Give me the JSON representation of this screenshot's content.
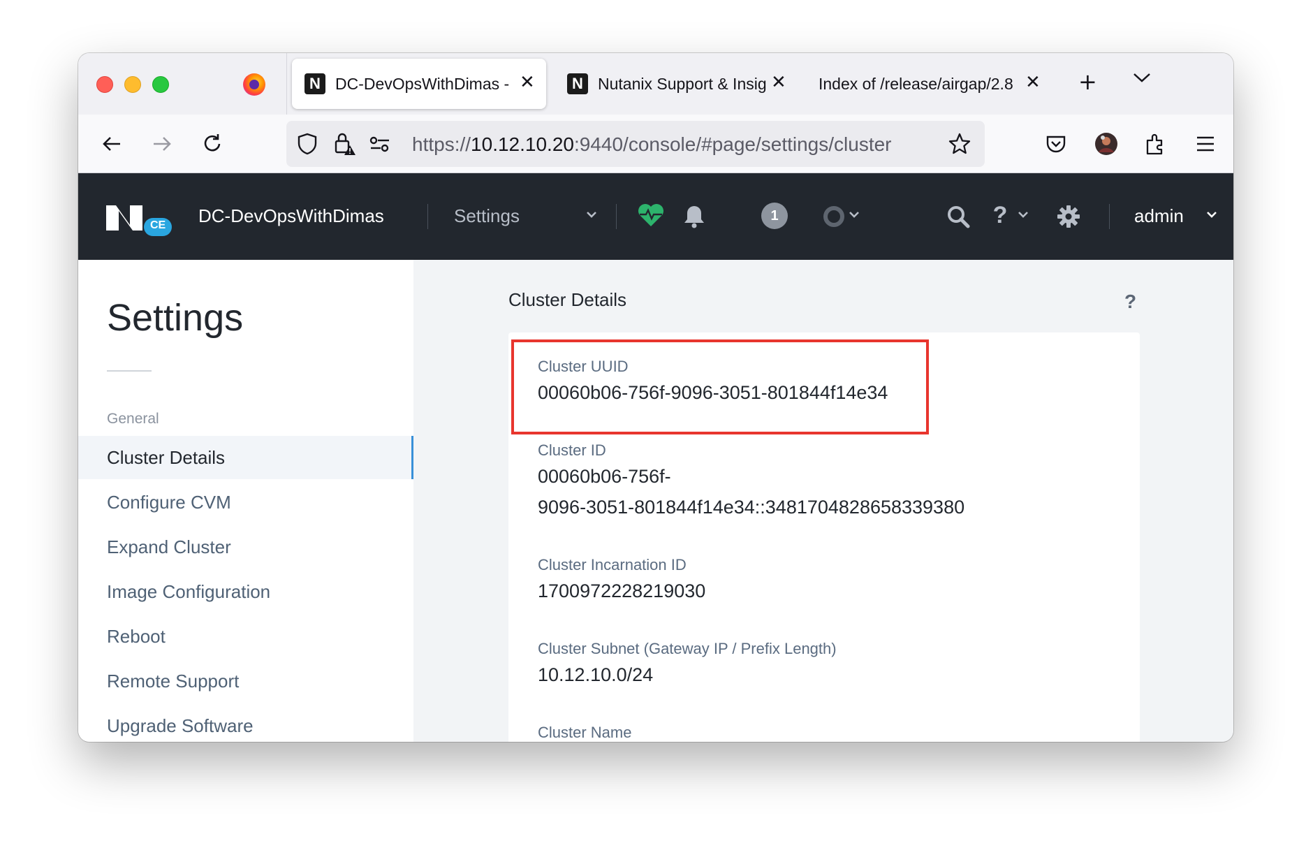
{
  "browser": {
    "tabs": [
      {
        "title": "DC-DevOpsWithDimas -",
        "active": true
      },
      {
        "title": "Nutanix Support & Insig",
        "active": false
      },
      {
        "title": "Index of /release/airgap/2.8",
        "active": false
      }
    ],
    "url": {
      "scheme": "https://",
      "host": "10.12.10.20",
      "rest": ":9440/console/#page/settings/cluster"
    }
  },
  "header": {
    "logo_badge": "CE",
    "cluster_name": "DC-DevOpsWithDimas",
    "section": "Settings",
    "alert_count": "1",
    "user": "admin",
    "help_glyph": "?"
  },
  "sidebar": {
    "title": "Settings",
    "group": "General",
    "items": [
      {
        "label": "Cluster Details",
        "active": true
      },
      {
        "label": "Configure CVM"
      },
      {
        "label": "Expand Cluster"
      },
      {
        "label": "Image Configuration"
      },
      {
        "label": "Reboot"
      },
      {
        "label": "Remote Support"
      },
      {
        "label": "Upgrade Software"
      }
    ]
  },
  "main": {
    "title": "Cluster Details",
    "help": "?",
    "fields": [
      {
        "label": "Cluster UUID",
        "value": "00060b06-756f-9096-3051-801844f14e34"
      },
      {
        "label": "Cluster ID",
        "value_line1": "00060b06-756f-",
        "value_line2": "9096-3051-801844f14e34::3481704828658339380"
      },
      {
        "label": "Cluster Incarnation ID",
        "value": "1700972228219030"
      },
      {
        "label": "Cluster Subnet (Gateway IP / Prefix Length)",
        "value": "10.12.10.0/24"
      },
      {
        "label": "Cluster Name"
      }
    ]
  },
  "colors": {
    "header_bg": "#22272e",
    "highlight_border": "#e8352e",
    "health_green": "#2db36c",
    "active_accent": "#3990d8"
  }
}
